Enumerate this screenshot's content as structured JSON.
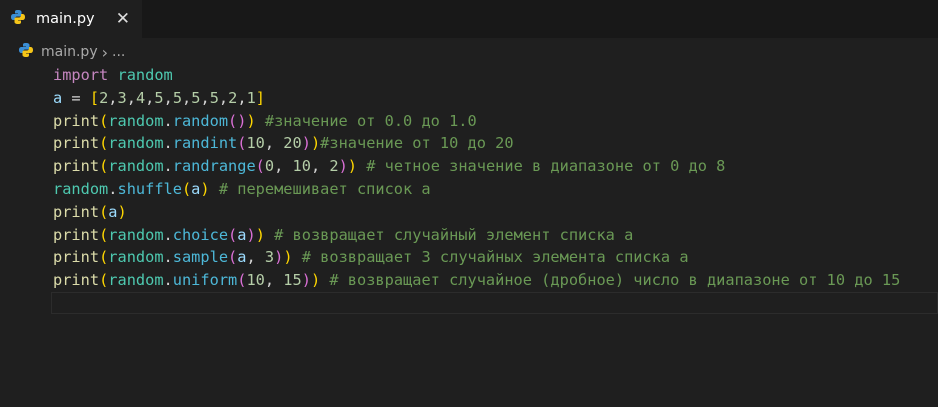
{
  "tab": {
    "title": "main.py",
    "icon": "python-icon",
    "close": "✕"
  },
  "breadcrumb": {
    "file": "main.py",
    "separator": "›",
    "more": "..."
  },
  "code": [
    [
      [
        "import",
        "kw"
      ],
      [
        " ",
        "p"
      ],
      [
        "random",
        "mod"
      ]
    ],
    [
      [
        "a",
        "var"
      ],
      [
        " = ",
        "p"
      ],
      [
        "[",
        "b1"
      ],
      [
        "2",
        "num"
      ],
      [
        ",",
        "p"
      ],
      [
        "3",
        "num"
      ],
      [
        ",",
        "p"
      ],
      [
        "4",
        "num"
      ],
      [
        ",",
        "p"
      ],
      [
        "5",
        "num"
      ],
      [
        ",",
        "p"
      ],
      [
        "5",
        "num"
      ],
      [
        ",",
        "p"
      ],
      [
        "5",
        "num"
      ],
      [
        ",",
        "p"
      ],
      [
        "5",
        "num"
      ],
      [
        ",",
        "p"
      ],
      [
        "2",
        "num"
      ],
      [
        ",",
        "p"
      ],
      [
        "1",
        "num"
      ],
      [
        "]",
        "b1"
      ]
    ],
    [
      [
        "print",
        "fn"
      ],
      [
        "(",
        "b1"
      ],
      [
        "random",
        "mod"
      ],
      [
        ".",
        "p"
      ],
      [
        "random",
        "meth"
      ],
      [
        "()",
        "b2"
      ],
      [
        ")",
        "b1"
      ],
      [
        " #значение от 0.0 до 1.0",
        "cm"
      ]
    ],
    [
      [
        "print",
        "fn"
      ],
      [
        "(",
        "b1"
      ],
      [
        "random",
        "mod"
      ],
      [
        ".",
        "p"
      ],
      [
        "randint",
        "meth"
      ],
      [
        "(",
        "b2"
      ],
      [
        "10",
        "num"
      ],
      [
        ", ",
        "p"
      ],
      [
        "20",
        "num"
      ],
      [
        ")",
        "b2"
      ],
      [
        ")",
        "b1"
      ],
      [
        "#значение от 10 до 20",
        "cm"
      ]
    ],
    [
      [
        "print",
        "fn"
      ],
      [
        "(",
        "b1"
      ],
      [
        "random",
        "mod"
      ],
      [
        ".",
        "p"
      ],
      [
        "randrange",
        "meth"
      ],
      [
        "(",
        "b2"
      ],
      [
        "0",
        "num"
      ],
      [
        ", ",
        "p"
      ],
      [
        "10",
        "num"
      ],
      [
        ", ",
        "p"
      ],
      [
        "2",
        "num"
      ],
      [
        ")",
        "b2"
      ],
      [
        ")",
        "b1"
      ],
      [
        " # четное значение в диапазоне от 0 до 8",
        "cm"
      ]
    ],
    [
      [
        "random",
        "mod"
      ],
      [
        ".",
        "p"
      ],
      [
        "shuffle",
        "meth"
      ],
      [
        "(",
        "b1"
      ],
      [
        "a",
        "var"
      ],
      [
        ")",
        "b1"
      ],
      [
        " # перемешивает список a",
        "cm"
      ]
    ],
    [
      [
        "print",
        "fn"
      ],
      [
        "(",
        "b1"
      ],
      [
        "a",
        "var"
      ],
      [
        ")",
        "b1"
      ]
    ],
    [
      [
        "print",
        "fn"
      ],
      [
        "(",
        "b1"
      ],
      [
        "random",
        "mod"
      ],
      [
        ".",
        "p"
      ],
      [
        "choice",
        "meth"
      ],
      [
        "(",
        "b2"
      ],
      [
        "a",
        "var"
      ],
      [
        ")",
        "b2"
      ],
      [
        ")",
        "b1"
      ],
      [
        " # возвращает случайный элемент списка a",
        "cm"
      ]
    ],
    [
      [
        "print",
        "fn"
      ],
      [
        "(",
        "b1"
      ],
      [
        "random",
        "mod"
      ],
      [
        ".",
        "p"
      ],
      [
        "sample",
        "meth"
      ],
      [
        "(",
        "b2"
      ],
      [
        "a",
        "var"
      ],
      [
        ", ",
        "p"
      ],
      [
        "3",
        "num"
      ],
      [
        ")",
        "b2"
      ],
      [
        ")",
        "b1"
      ],
      [
        " # возвращает 3 случайных элемента списка a",
        "cm"
      ]
    ],
    [
      [
        "print",
        "fn"
      ],
      [
        "(",
        "b1"
      ],
      [
        "random",
        "mod"
      ],
      [
        ".",
        "p"
      ],
      [
        "uniform",
        "meth"
      ],
      [
        "(",
        "b2"
      ],
      [
        "10",
        "num"
      ],
      [
        ", ",
        "p"
      ],
      [
        "15",
        "num"
      ],
      [
        ")",
        "b2"
      ],
      [
        ")",
        "b1"
      ],
      [
        " # возвращает случайное (дробное) число в диапазоне от 10 до 15",
        "cm"
      ]
    ]
  ]
}
